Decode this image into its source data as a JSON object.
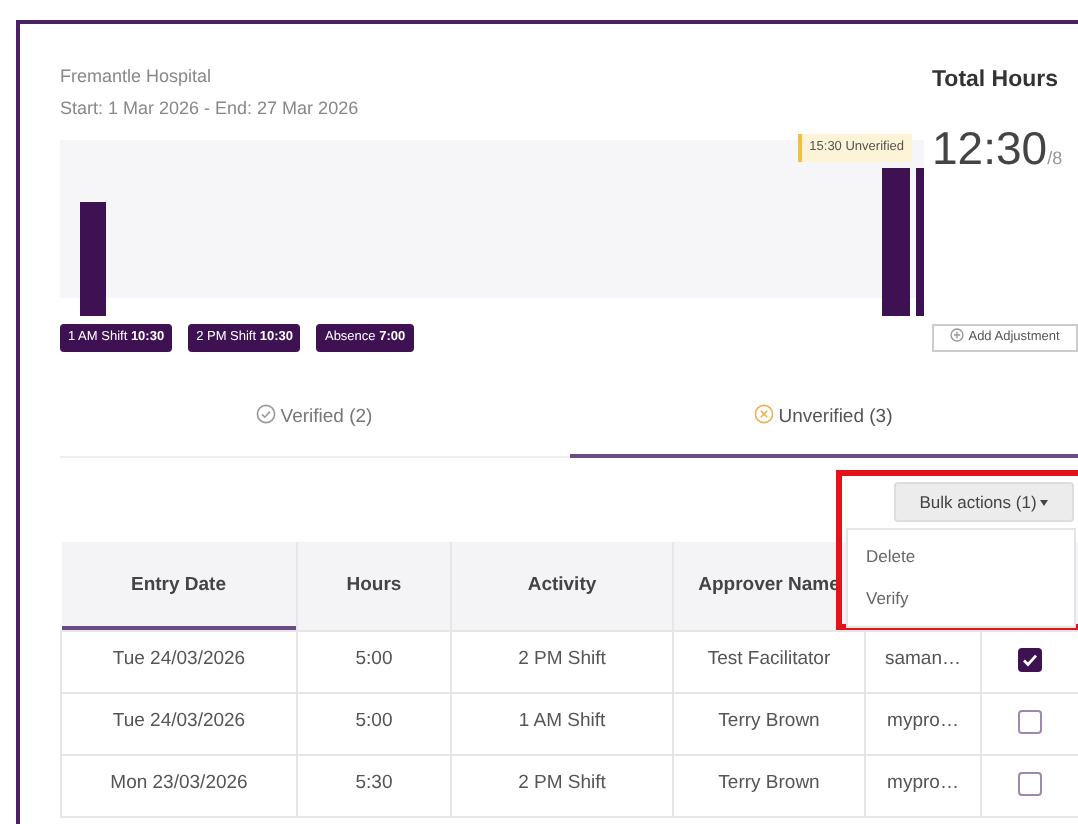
{
  "card": {
    "site": "Fremantle Hospital",
    "period": "Start: 1 Mar 2026 - End: 27 Mar 2026",
    "total": {
      "label": "Total Hours",
      "value": "12:30",
      "target": "/8"
    },
    "chart": {
      "tag": "15:30 Unverified"
    },
    "legend": [
      "1 AM Shift **10:30**",
      "2 PM Shift **10:30**",
      "Absence **7:00**"
    ],
    "add_adjustment": "Add Adjustment"
  },
  "tabs": [
    {
      "label": "Verified (2)",
      "kind": "verified",
      "selected": false
    },
    {
      "label": "Unverified (3)",
      "kind": "unverified",
      "selected": true
    }
  ],
  "bulk_actions": {
    "label": "Bulk actions (1)",
    "highlighted": true,
    "menu": [
      "Delete",
      "Verify"
    ]
  },
  "table": {
    "columns": [
      {
        "label": "Entry Date",
        "sorted": true
      },
      {
        "label": "Hours",
        "sorted": false
      },
      {
        "label": "Activity",
        "sorted": false
      },
      {
        "label": "Approver Name",
        "sorted": false
      }
    ],
    "rows": [
      {
        "cells": [
          "Tue 24/03/2026",
          "5:00",
          "2 PM Shift",
          "Test Facilitator",
          "saman…"
        ],
        "checked": true
      },
      {
        "cells": [
          "Tue 24/03/2026",
          "5:00",
          "1 AM Shift",
          "Terry Brown",
          "mypro…"
        ],
        "checked": false
      },
      {
        "cells": [
          "Mon 23/03/2026",
          "5:30",
          "2 PM Shift",
          "Terry Brown",
          "mypro…"
        ],
        "checked": false
      }
    ]
  }
}
